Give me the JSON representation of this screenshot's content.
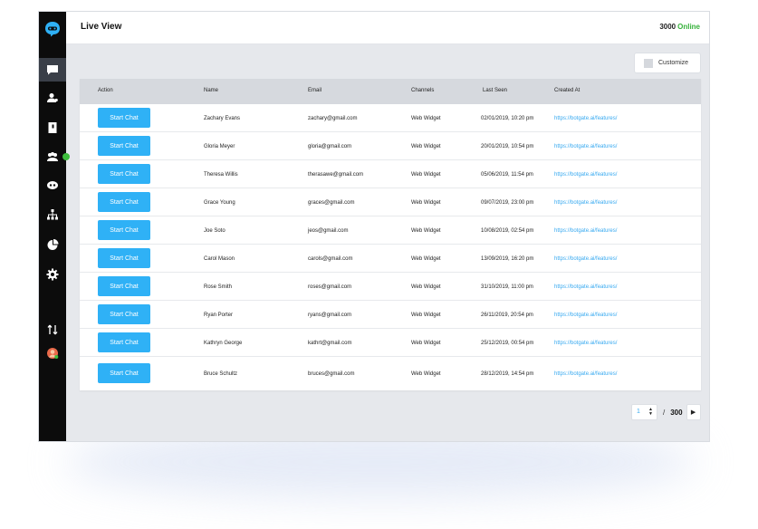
{
  "header": {
    "title": "Live View",
    "online_count": "3000",
    "online_label": "Online"
  },
  "toolbar": {
    "customize_label": "Customize"
  },
  "sidebar": {
    "items": [
      {
        "name": "chat-icon"
      },
      {
        "name": "users-icon"
      },
      {
        "name": "contacts-icon"
      },
      {
        "name": "team-icon"
      },
      {
        "name": "bot-icon"
      },
      {
        "name": "hierarchy-icon"
      },
      {
        "name": "analytics-icon"
      },
      {
        "name": "settings-icon"
      },
      {
        "name": "transfer-icon"
      },
      {
        "name": "avatar"
      }
    ]
  },
  "table": {
    "columns": [
      "Action",
      "Name",
      "Email",
      "Channels",
      "Last Seen",
      "Created At"
    ],
    "action_label": "Start Chat",
    "rows": [
      {
        "name": "Zachary Evans",
        "email": "zachary@gmail.com",
        "channel": "Web Widget",
        "last_seen": "02/01/2019, 10:20 pm",
        "created_at": "https://botgate.ai/features/"
      },
      {
        "name": "Gloria Meyer",
        "email": "gloria@gmail.com",
        "channel": "Web Widget",
        "last_seen": "20/01/2019, 10:54 pm",
        "created_at": "https://botgate.ai/features/"
      },
      {
        "name": "Theresa Willis",
        "email": "therasawe@gmail.com",
        "channel": "Web Widget",
        "last_seen": "05/06/2019, 11:54 pm",
        "created_at": "https://botgate.ai/features/"
      },
      {
        "name": "Grace Young",
        "email": "graces@gmail.com",
        "channel": "Web Widget",
        "last_seen": "09/07/2019, 23:00 pm",
        "created_at": "https://botgate.ai/features/"
      },
      {
        "name": "Joe Soto",
        "email": "jeos@gmail.com",
        "channel": "Web Widget",
        "last_seen": "10/08/2019, 02:54 pm",
        "created_at": "https://botgate.ai/features/"
      },
      {
        "name": "Carol Mason",
        "email": "carols@gmail.com",
        "channel": "Web Widget",
        "last_seen": "13/09/2019, 16:20 pm",
        "created_at": "https://botgate.ai/features/"
      },
      {
        "name": "Rose Smith",
        "email": "roses@gmail.com",
        "channel": "Web Widget",
        "last_seen": "31/10/2019, 11:00 pm",
        "created_at": "https://botgate.ai/features/"
      },
      {
        "name": "Ryan Porter",
        "email": "ryans@gmail.com",
        "channel": "Web Widget",
        "last_seen": "26/11/2019, 20:54 pm",
        "created_at": "https://botgate.ai/features/"
      },
      {
        "name": "Kathryn George",
        "email": "kathrt@gmail.com",
        "channel": "Web Widget",
        "last_seen": "25/12/2019, 00:54 pm",
        "created_at": "https://botgate.ai/features/"
      },
      {
        "name": "Bruce Schultz",
        "email": "bruces@gmail.com",
        "channel": "Web Widget",
        "last_seen": "28/12/2019, 14:54 pm",
        "created_at": "https://botgate.ai/features/"
      }
    ]
  },
  "pagination": {
    "current_page": "1",
    "separator": "/",
    "total_pages": "300"
  },
  "colors": {
    "accent": "#2fb1f6",
    "online": "#35b13a",
    "sidebar": "#0c0c0c",
    "link": "#37a9f0"
  }
}
